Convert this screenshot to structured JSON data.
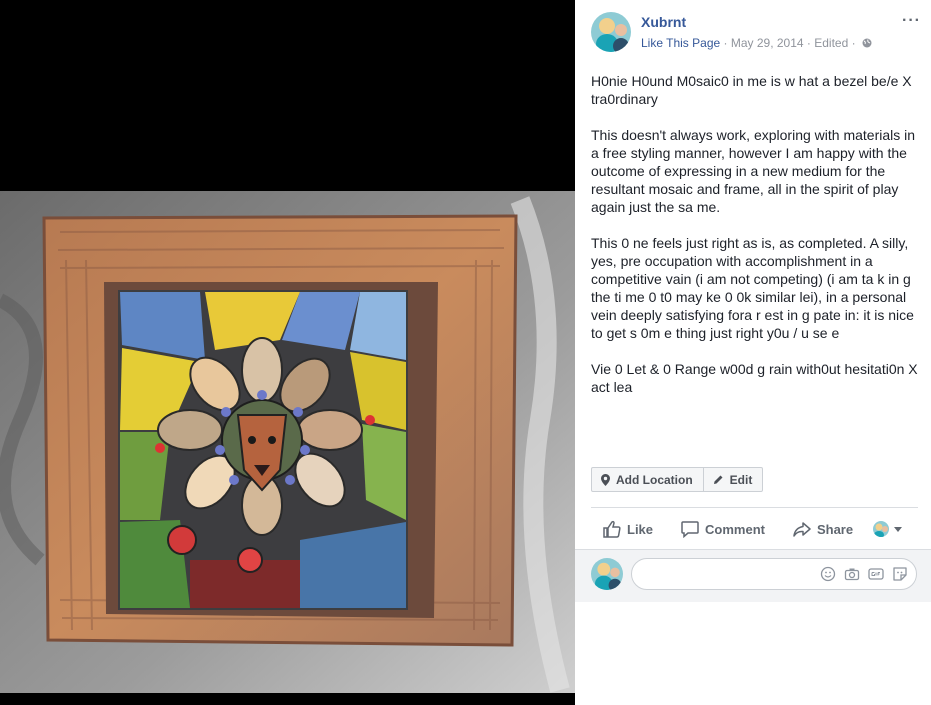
{
  "post": {
    "page_name": "Xubrnt",
    "like_page": "Like This Page",
    "dot1": " · ",
    "date": "May 29, 2014",
    "dot2": " · ",
    "edited": "Edited",
    "dot3": " · ",
    "more_label": "···",
    "paragraphs": [
      "H0nie H0und M0saic0 in me is w hat a bezel be/e X tra0rdinary",
      "This doesn't always work, exploring with materials in a free styling manner, however I am happy with the outcome of expressing in a new medium for the resultant mosaic and frame, all in the spirit of play again just the sa me.",
      "This 0 ne feels just right as is, as completed. A silly, yes, pre occupation with accomplishment in a competitive vain (i am not competing) (i am ta k in g the ti me 0 t0 may ke 0 0k similar lei), in a personal vein deeply satisfying fora r est in g pate in: it is nice to get s 0m e thing just right y0u / u se e",
      "Vie 0 Let & 0 Range w00d g rain with0ut hesitati0n X act lea"
    ]
  },
  "buttons": {
    "add_location": "Add Location",
    "edit": "Edit"
  },
  "actions": {
    "like": "Like",
    "comment": "Comment",
    "share": "Share"
  },
  "comment_box": {
    "placeholder": ""
  },
  "colors": {
    "link": "#365899",
    "muted": "#90949c",
    "text": "#1d2129"
  },
  "icons": [
    "globe-icon",
    "more-icon",
    "location-pin-icon",
    "pencil-icon",
    "like-icon",
    "comment-icon",
    "share-icon",
    "emoji-icon",
    "camera-icon",
    "gif-icon",
    "sticker-icon",
    "chevron-down-icon"
  ]
}
